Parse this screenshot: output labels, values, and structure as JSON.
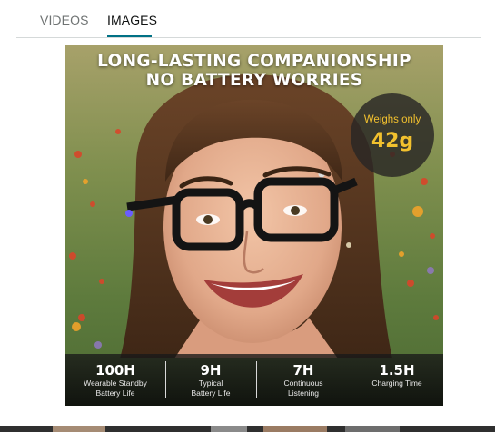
{
  "tabs": [
    {
      "label": "VIDEOS",
      "active": false
    },
    {
      "label": "IMAGES",
      "active": true
    }
  ],
  "image": {
    "headline_line1": "LONG-LASTING COMPANIONSHIP",
    "headline_line2": "NO BATTERY WORRIES",
    "badge": {
      "label": "Weighs only",
      "value": "42g"
    },
    "stats": [
      {
        "value": "100H",
        "label_line1": "Wearable Standby",
        "label_line2": "Battery Life"
      },
      {
        "value": "9H",
        "label_line1": "Typical",
        "label_line2": "Battery Life"
      },
      {
        "value": "7H",
        "label_line1": "Continuous",
        "label_line2": "Listening"
      },
      {
        "value": "1.5H",
        "label_line1": "Charging Time",
        "label_line2": ""
      }
    ]
  },
  "colors": {
    "accent_underline": "#007185",
    "badge_text": "#f2c12e",
    "tab_inactive": "#6f7373",
    "tab_active": "#0f1111"
  }
}
